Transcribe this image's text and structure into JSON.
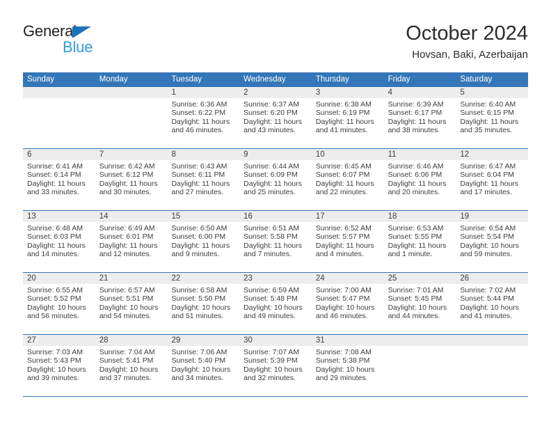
{
  "brand": {
    "line1": "General",
    "line2": "Blue",
    "triangle_color": "#1d71b8",
    "line2_color": "#2e9bdf"
  },
  "header": {
    "title": "October 2024",
    "subtitle": "Hovsan, Baki, Azerbaijan"
  },
  "theme": {
    "header_blue": "#3476b8",
    "daynum_bg": "#ededed",
    "text": "#3d3d3d"
  },
  "weekdays": [
    "Sunday",
    "Monday",
    "Tuesday",
    "Wednesday",
    "Thursday",
    "Friday",
    "Saturday"
  ],
  "labels": {
    "sunrise_prefix": "Sunrise:",
    "sunset_prefix": "Sunset:",
    "daylight_prefix": "Daylight:"
  },
  "weeks": [
    [
      {
        "day": "",
        "empty": true
      },
      {
        "day": "",
        "empty": true
      },
      {
        "day": "1",
        "sunrise": "Sunrise: 6:36 AM",
        "sunset": "Sunset: 6:22 PM",
        "daylight1": "Daylight: 11 hours",
        "daylight2": "and 46 minutes."
      },
      {
        "day": "2",
        "sunrise": "Sunrise: 6:37 AM",
        "sunset": "Sunset: 6:20 PM",
        "daylight1": "Daylight: 11 hours",
        "daylight2": "and 43 minutes."
      },
      {
        "day": "3",
        "sunrise": "Sunrise: 6:38 AM",
        "sunset": "Sunset: 6:19 PM",
        "daylight1": "Daylight: 11 hours",
        "daylight2": "and 41 minutes."
      },
      {
        "day": "4",
        "sunrise": "Sunrise: 6:39 AM",
        "sunset": "Sunset: 6:17 PM",
        "daylight1": "Daylight: 11 hours",
        "daylight2": "and 38 minutes."
      },
      {
        "day": "5",
        "sunrise": "Sunrise: 6:40 AM",
        "sunset": "Sunset: 6:15 PM",
        "daylight1": "Daylight: 11 hours",
        "daylight2": "and 35 minutes."
      }
    ],
    [
      {
        "day": "6",
        "sunrise": "Sunrise: 6:41 AM",
        "sunset": "Sunset: 6:14 PM",
        "daylight1": "Daylight: 11 hours",
        "daylight2": "and 33 minutes."
      },
      {
        "day": "7",
        "sunrise": "Sunrise: 6:42 AM",
        "sunset": "Sunset: 6:12 PM",
        "daylight1": "Daylight: 11 hours",
        "daylight2": "and 30 minutes."
      },
      {
        "day": "8",
        "sunrise": "Sunrise: 6:43 AM",
        "sunset": "Sunset: 6:11 PM",
        "daylight1": "Daylight: 11 hours",
        "daylight2": "and 27 minutes."
      },
      {
        "day": "9",
        "sunrise": "Sunrise: 6:44 AM",
        "sunset": "Sunset: 6:09 PM",
        "daylight1": "Daylight: 11 hours",
        "daylight2": "and 25 minutes."
      },
      {
        "day": "10",
        "sunrise": "Sunrise: 6:45 AM",
        "sunset": "Sunset: 6:07 PM",
        "daylight1": "Daylight: 11 hours",
        "daylight2": "and 22 minutes."
      },
      {
        "day": "11",
        "sunrise": "Sunrise: 6:46 AM",
        "sunset": "Sunset: 6:06 PM",
        "daylight1": "Daylight: 11 hours",
        "daylight2": "and 20 minutes."
      },
      {
        "day": "12",
        "sunrise": "Sunrise: 6:47 AM",
        "sunset": "Sunset: 6:04 PM",
        "daylight1": "Daylight: 11 hours",
        "daylight2": "and 17 minutes."
      }
    ],
    [
      {
        "day": "13",
        "sunrise": "Sunrise: 6:48 AM",
        "sunset": "Sunset: 6:03 PM",
        "daylight1": "Daylight: 11 hours",
        "daylight2": "and 14 minutes."
      },
      {
        "day": "14",
        "sunrise": "Sunrise: 6:49 AM",
        "sunset": "Sunset: 6:01 PM",
        "daylight1": "Daylight: 11 hours",
        "daylight2": "and 12 minutes."
      },
      {
        "day": "15",
        "sunrise": "Sunrise: 6:50 AM",
        "sunset": "Sunset: 6:00 PM",
        "daylight1": "Daylight: 11 hours",
        "daylight2": "and 9 minutes."
      },
      {
        "day": "16",
        "sunrise": "Sunrise: 6:51 AM",
        "sunset": "Sunset: 5:58 PM",
        "daylight1": "Daylight: 11 hours",
        "daylight2": "and 7 minutes."
      },
      {
        "day": "17",
        "sunrise": "Sunrise: 6:52 AM",
        "sunset": "Sunset: 5:57 PM",
        "daylight1": "Daylight: 11 hours",
        "daylight2": "and 4 minutes."
      },
      {
        "day": "18",
        "sunrise": "Sunrise: 6:53 AM",
        "sunset": "Sunset: 5:55 PM",
        "daylight1": "Daylight: 11 hours",
        "daylight2": "and 1 minute."
      },
      {
        "day": "19",
        "sunrise": "Sunrise: 6:54 AM",
        "sunset": "Sunset: 5:54 PM",
        "daylight1": "Daylight: 10 hours",
        "daylight2": "and 59 minutes."
      }
    ],
    [
      {
        "day": "20",
        "sunrise": "Sunrise: 6:55 AM",
        "sunset": "Sunset: 5:52 PM",
        "daylight1": "Daylight: 10 hours",
        "daylight2": "and 56 minutes."
      },
      {
        "day": "21",
        "sunrise": "Sunrise: 6:57 AM",
        "sunset": "Sunset: 5:51 PM",
        "daylight1": "Daylight: 10 hours",
        "daylight2": "and 54 minutes."
      },
      {
        "day": "22",
        "sunrise": "Sunrise: 6:58 AM",
        "sunset": "Sunset: 5:50 PM",
        "daylight1": "Daylight: 10 hours",
        "daylight2": "and 51 minutes."
      },
      {
        "day": "23",
        "sunrise": "Sunrise: 6:59 AM",
        "sunset": "Sunset: 5:48 PM",
        "daylight1": "Daylight: 10 hours",
        "daylight2": "and 49 minutes."
      },
      {
        "day": "24",
        "sunrise": "Sunrise: 7:00 AM",
        "sunset": "Sunset: 5:47 PM",
        "daylight1": "Daylight: 10 hours",
        "daylight2": "and 46 minutes."
      },
      {
        "day": "25",
        "sunrise": "Sunrise: 7:01 AM",
        "sunset": "Sunset: 5:45 PM",
        "daylight1": "Daylight: 10 hours",
        "daylight2": "and 44 minutes."
      },
      {
        "day": "26",
        "sunrise": "Sunrise: 7:02 AM",
        "sunset": "Sunset: 5:44 PM",
        "daylight1": "Daylight: 10 hours",
        "daylight2": "and 41 minutes."
      }
    ],
    [
      {
        "day": "27",
        "sunrise": "Sunrise: 7:03 AM",
        "sunset": "Sunset: 5:43 PM",
        "daylight1": "Daylight: 10 hours",
        "daylight2": "and 39 minutes."
      },
      {
        "day": "28",
        "sunrise": "Sunrise: 7:04 AM",
        "sunset": "Sunset: 5:41 PM",
        "daylight1": "Daylight: 10 hours",
        "daylight2": "and 37 minutes."
      },
      {
        "day": "29",
        "sunrise": "Sunrise: 7:06 AM",
        "sunset": "Sunset: 5:40 PM",
        "daylight1": "Daylight: 10 hours",
        "daylight2": "and 34 minutes."
      },
      {
        "day": "30",
        "sunrise": "Sunrise: 7:07 AM",
        "sunset": "Sunset: 5:39 PM",
        "daylight1": "Daylight: 10 hours",
        "daylight2": "and 32 minutes."
      },
      {
        "day": "31",
        "sunrise": "Sunrise: 7:08 AM",
        "sunset": "Sunset: 5:38 PM",
        "daylight1": "Daylight: 10 hours",
        "daylight2": "and 29 minutes."
      },
      {
        "day": "",
        "empty": true
      },
      {
        "day": "",
        "empty": true
      }
    ]
  ]
}
